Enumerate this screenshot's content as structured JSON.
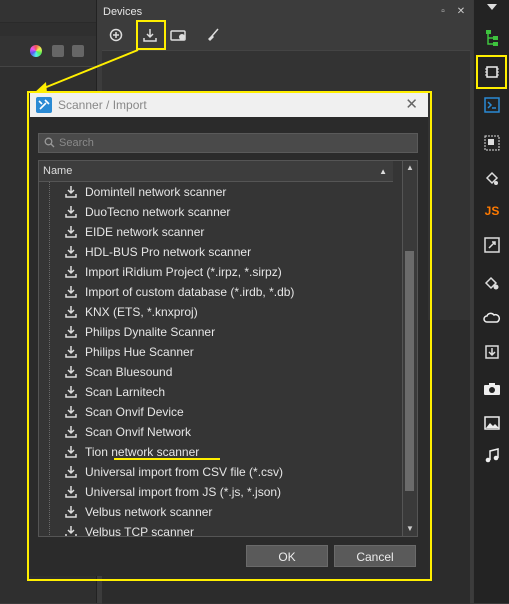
{
  "devices_panel": {
    "title": "Devices"
  },
  "dialog": {
    "title": "Scanner / Import",
    "close_glyph": "✕",
    "search": {
      "placeholder": "Search",
      "value": ""
    },
    "list": {
      "column_header": "Name",
      "items": [
        "Domintell network scanner",
        "DuoTecno network scanner",
        "EIDE network scanner",
        "HDL-BUS Pro network scanner",
        "Import iRidium Project (*.irpz, *.sirpz)",
        "Import of custom database (*.irdb, *.db)",
        "KNX (ETS, *.knxproj)",
        "Philips Dynalite Scanner",
        "Philips Hue Scanner",
        "Scan Bluesound",
        "Scan Larnitech",
        "Scan Onvif Device",
        "Scan Onvif Network",
        "Tion network scanner",
        "Universal import from CSV file (*.csv)",
        "Universal import from JS (*.js, *.json)",
        "Velbus network scanner",
        "Velbus TCP scanner"
      ],
      "highlighted_item": "Philips Hue Scanner"
    },
    "ok_label": "OK",
    "cancel_label": "Cancel"
  },
  "right_toolbar": {
    "js_label": "JS"
  },
  "colors": {
    "highlight": "#ffef00",
    "accent_blue": "#2a8ad4",
    "js_orange": "#ff7a00",
    "tree_green": "#3ec43e"
  }
}
